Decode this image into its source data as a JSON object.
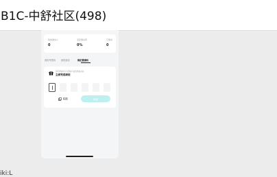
{
  "window": {
    "title": "B1C-中舒社区(498)"
  },
  "stats": [
    {
      "label": "我的邀请人",
      "value": "0"
    },
    {
      "label": "活跃邀请率",
      "value": "0%"
    },
    {
      "label": "已邀请",
      "value": "0"
    }
  ],
  "tabs": [
    {
      "label": "我的专属码"
    },
    {
      "label": "我的邀请"
    },
    {
      "label": "绑定邀请码"
    }
  ],
  "invite": {
    "hint": "填写邀请码可与邀请人建立邀请关系",
    "title": "立即完成绑定",
    "code_boxes": [
      "",
      "",
      "",
      "",
      "",
      ""
    ],
    "paste_label": "粘贴",
    "bind_label": "绑定"
  },
  "bottom": {
    "text": "iki:L"
  },
  "colors": {
    "accent_disabled": "#bff0f1",
    "gift": "#111111"
  }
}
